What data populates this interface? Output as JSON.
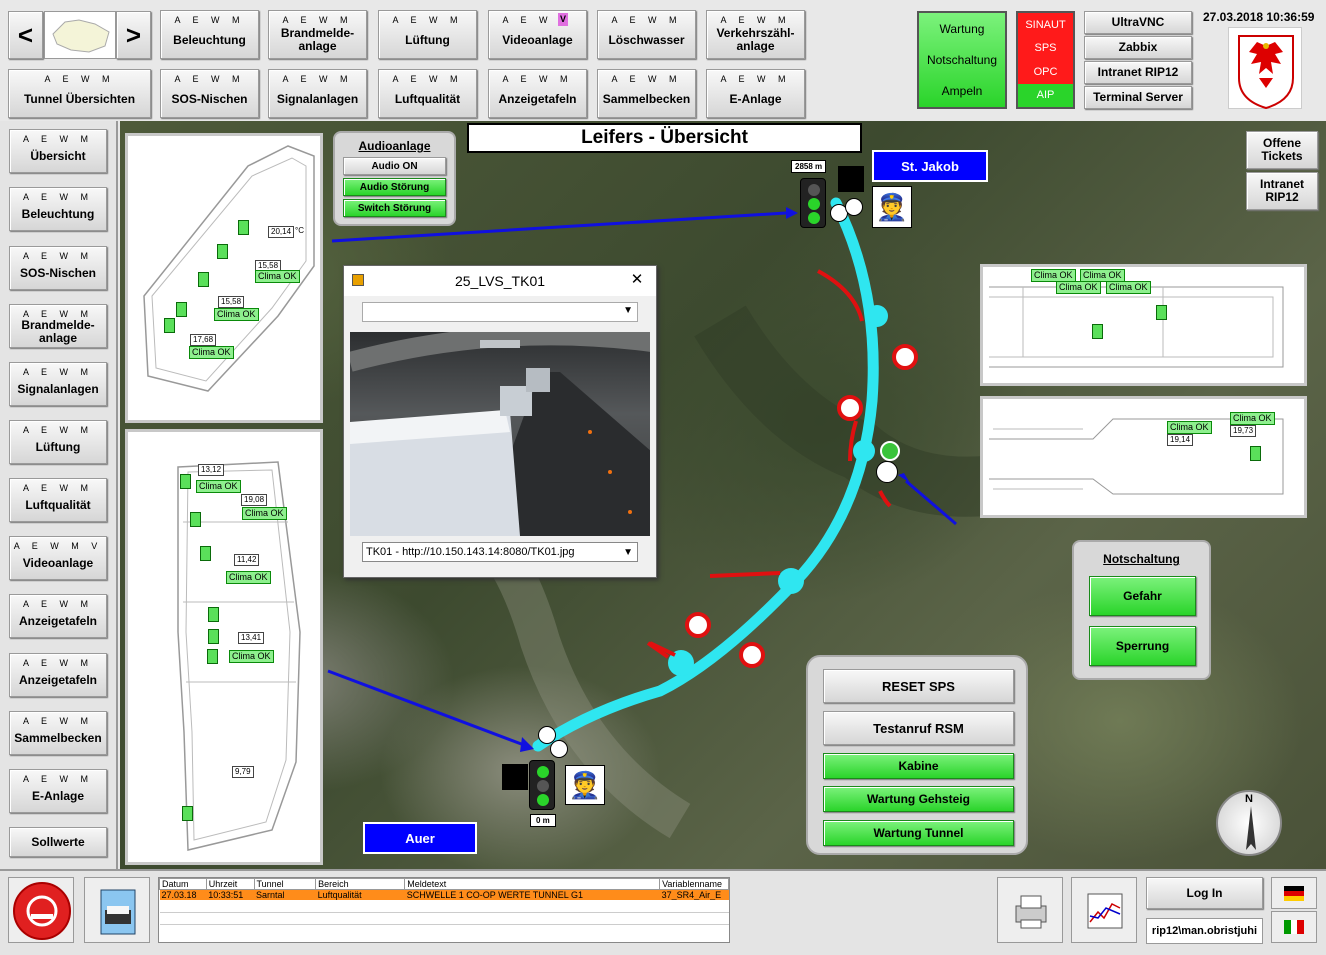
{
  "header": {
    "nav_prev": "<",
    "nav_next": ">",
    "datetime": "27.03.2018 10:36:59",
    "row1": [
      {
        "flags": "A E W M",
        "label": "Beleuchtung"
      },
      {
        "flags": "A E W M",
        "label": "Brandmelde-anlage"
      },
      {
        "flags": "A E W M",
        "label": "Lüftung"
      },
      {
        "flags": "A E W M",
        "flag_v": "V",
        "label": "Videoanlage"
      },
      {
        "flags": "A E W M",
        "label": "Löschwasser"
      },
      {
        "flags": "A E W M",
        "label": "Verkehrszähl-anlage"
      }
    ],
    "row2": [
      {
        "flags": "A E W M",
        "label": "Tunnel Übersichten"
      },
      {
        "flags": "A E W M",
        "label": "SOS-Nischen"
      },
      {
        "flags": "A E W M",
        "label": "Signalanlagen"
      },
      {
        "flags": "A E W M",
        "label": "Luftqualität"
      },
      {
        "flags": "A E W M",
        "label": "Anzeigetafeln"
      },
      {
        "flags": "A E W M",
        "label": "Sammelbecken"
      },
      {
        "flags": "A E W M",
        "label": "E-Anlage"
      }
    ],
    "wartung": [
      "Wartung",
      "Notschaltung",
      "Ampeln"
    ],
    "sps": [
      "SINAUT",
      "SPS",
      "OPC",
      "AIP"
    ],
    "servers": [
      "UltraVNC",
      "Zabbix",
      "Intranet RIP12",
      "Terminal Server"
    ]
  },
  "sidebar": [
    {
      "flags": "A E W M",
      "label": "Übersicht"
    },
    {
      "flags": "A E W M",
      "label": "Beleuchtung"
    },
    {
      "flags": "A E W M",
      "label": "SOS-Nischen"
    },
    {
      "flags": "A E W M",
      "label": "Brandmelde-anlage"
    },
    {
      "flags": "A E W M",
      "label": "Signalanlagen"
    },
    {
      "flags": "A E W M",
      "label": "Lüftung"
    },
    {
      "flags": "A E W M",
      "label": "Luftqualität"
    },
    {
      "flags": "A E W M V",
      "label": "Videoanlage"
    },
    {
      "flags": "A E W M",
      "label": "Anzeigetafeln"
    },
    {
      "flags": "A E W M",
      "label": "Anzeigetafeln"
    },
    {
      "flags": "A E W M",
      "label": "Sammelbecken"
    },
    {
      "flags": "A E W M",
      "label": "E-Anlage"
    },
    {
      "flags": "",
      "label": "Sollwerte"
    }
  ],
  "main": {
    "title": "Leifers - Übersicht",
    "st_jakob": "St. Jakob",
    "auer": "Auer",
    "km_top": "2858 m",
    "km_bottom": "0 m",
    "offene_tickets": "Offene Tickets",
    "intranet": "Intranet RIP12"
  },
  "audio": {
    "title": "Audioanlage",
    "on": "Audio ON",
    "stoerung": "Audio Störung",
    "switch": "Switch Störung"
  },
  "video": {
    "window_title": "25_LVS_TK01",
    "url": "TK01 - http://10.150.143.14:8080/TK01.jpg"
  },
  "notschaltung": {
    "title": "Notschaltung",
    "gefahr": "Gefahr",
    "sperrung": "Sperrung"
  },
  "reset": {
    "reset": "RESET SPS",
    "testanruf": "Testanruf RSM",
    "kabine": "Kabine",
    "gehsteig": "Wartung Gehsteig",
    "tunnel": "Wartung Tunnel"
  },
  "compass": "N",
  "tunnel_top_temps": [
    {
      "t": "20,14"
    },
    {
      "t": "15,58",
      "c": "Clima OK"
    },
    {
      "t": "15,58",
      "c": "Clima OK"
    },
    {
      "t": "17,68",
      "c": "Clima OK"
    }
  ],
  "tunnel_bottom_temps": [
    {
      "t": "13,12",
      "c": "Clima OK"
    },
    {
      "t": "19,08",
      "c": "Clima OK"
    },
    {
      "t": "11,42",
      "c": "Clima OK"
    },
    {
      "t": "13,41",
      "c": "Clima OK"
    },
    {
      "t": "9,79"
    }
  ],
  "unit": "°C",
  "right_panel_top": [
    "Clima OK",
    "Clima OK",
    "Clima OK",
    "Clima OK"
  ],
  "right_panel_bottom": [
    {
      "c": "Clima OK",
      "t": "19,14"
    },
    {
      "c": "Clima OK",
      "t": "19,73"
    }
  ],
  "alarms": {
    "headers": [
      "Datum",
      "Uhrzeit",
      "Tunnel",
      "Bereich",
      "Meldetext",
      "Variablenname"
    ],
    "rows": [
      [
        "27.03.18",
        "10:33:51",
        "Sarntal",
        "Luftqualität",
        "SCHWELLE 1 CO-OP WERTE TUNNEL G1",
        "37_SR4_Air_E"
      ]
    ]
  },
  "footer": {
    "login": "Log In",
    "user": "rip12\\man.obristjuhi"
  },
  "colors": {
    "accent_green": "#2ad42a",
    "alarm_orange": "#ff8c1a",
    "route_cyan": "#2fe6f0",
    "label_blue": "#0000ff"
  }
}
